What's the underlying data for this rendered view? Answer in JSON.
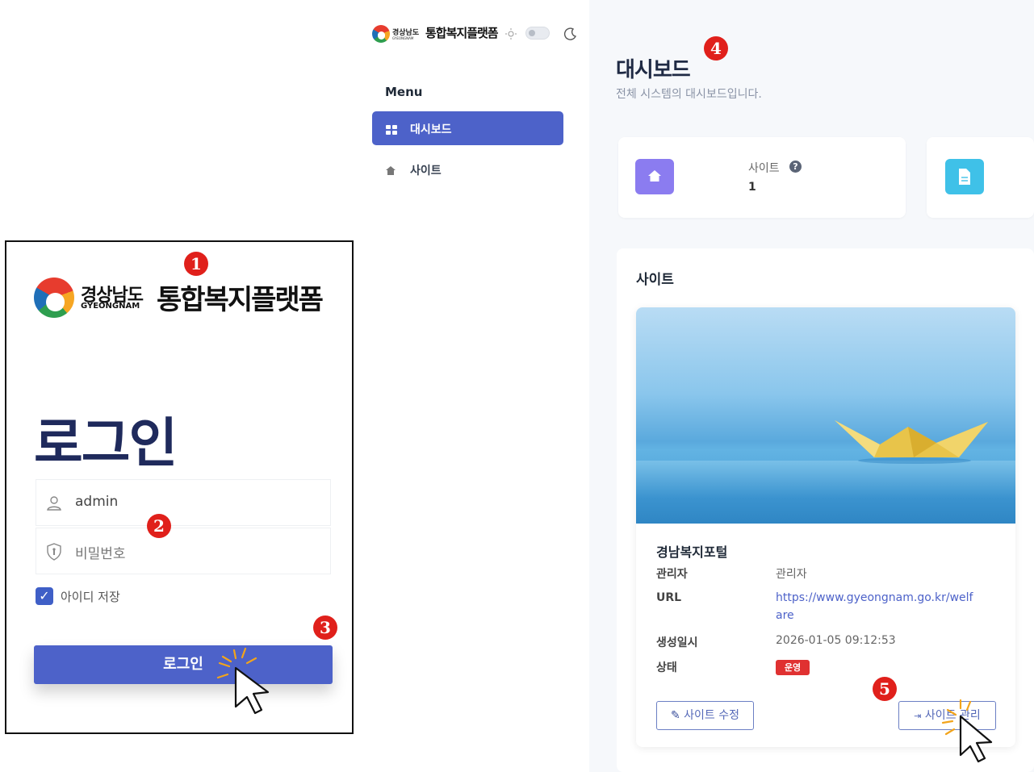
{
  "login": {
    "region_ko": "경상남도",
    "region_en": "GYEONGNAM",
    "platform_name": "통합복지플랫폼",
    "title": "로그인",
    "username_value": "admin",
    "password_placeholder": "비밀번호",
    "remember_label": "아이디 저장",
    "remember_checked": true,
    "submit_label": "로그인"
  },
  "markers": [
    "1",
    "2",
    "3",
    "4",
    "5"
  ],
  "sidebar": {
    "brand_region": "경상남도",
    "brand_region_en": "GYEONGNAM",
    "brand_name": "통합복지플랫폼",
    "menu_label": "Menu",
    "items": [
      {
        "label": "대시보드",
        "icon": "dashboard-grid-icon",
        "active": true
      },
      {
        "label": "사이트",
        "icon": "home-icon",
        "active": false
      }
    ],
    "theme_toggle": {
      "light_icon": "sun-icon",
      "dark_icon": "moon-icon",
      "value": "light"
    }
  },
  "dashboard": {
    "title": "대시보드",
    "subtitle": "전체 시스템의 대시보드입니다.",
    "stat": {
      "label": "사이트",
      "value": "1",
      "help_icon": "question-icon"
    },
    "section_title": "사이트",
    "site": {
      "name": "경남복지포털",
      "rows": [
        {
          "label": "관리자",
          "value": "관리자"
        },
        {
          "label": "URL",
          "value": "https://www.gyeongnam.go.kr/welf",
          "value_cont": "are"
        },
        {
          "label": "생성일시",
          "value": "2026-01-05 09:12:53"
        },
        {
          "label": "상태",
          "value": "운영"
        }
      ],
      "edit_label": "사이트 수정",
      "manage_label": "사이트 관리"
    }
  },
  "colors": {
    "primary": "#4d62c9",
    "title_navy": "#1f2a5c",
    "marker_red": "#e0201b",
    "status_red": "#e03131",
    "stat_purple": "#8b7cf0",
    "stat_cyan": "#3fc1e8"
  }
}
